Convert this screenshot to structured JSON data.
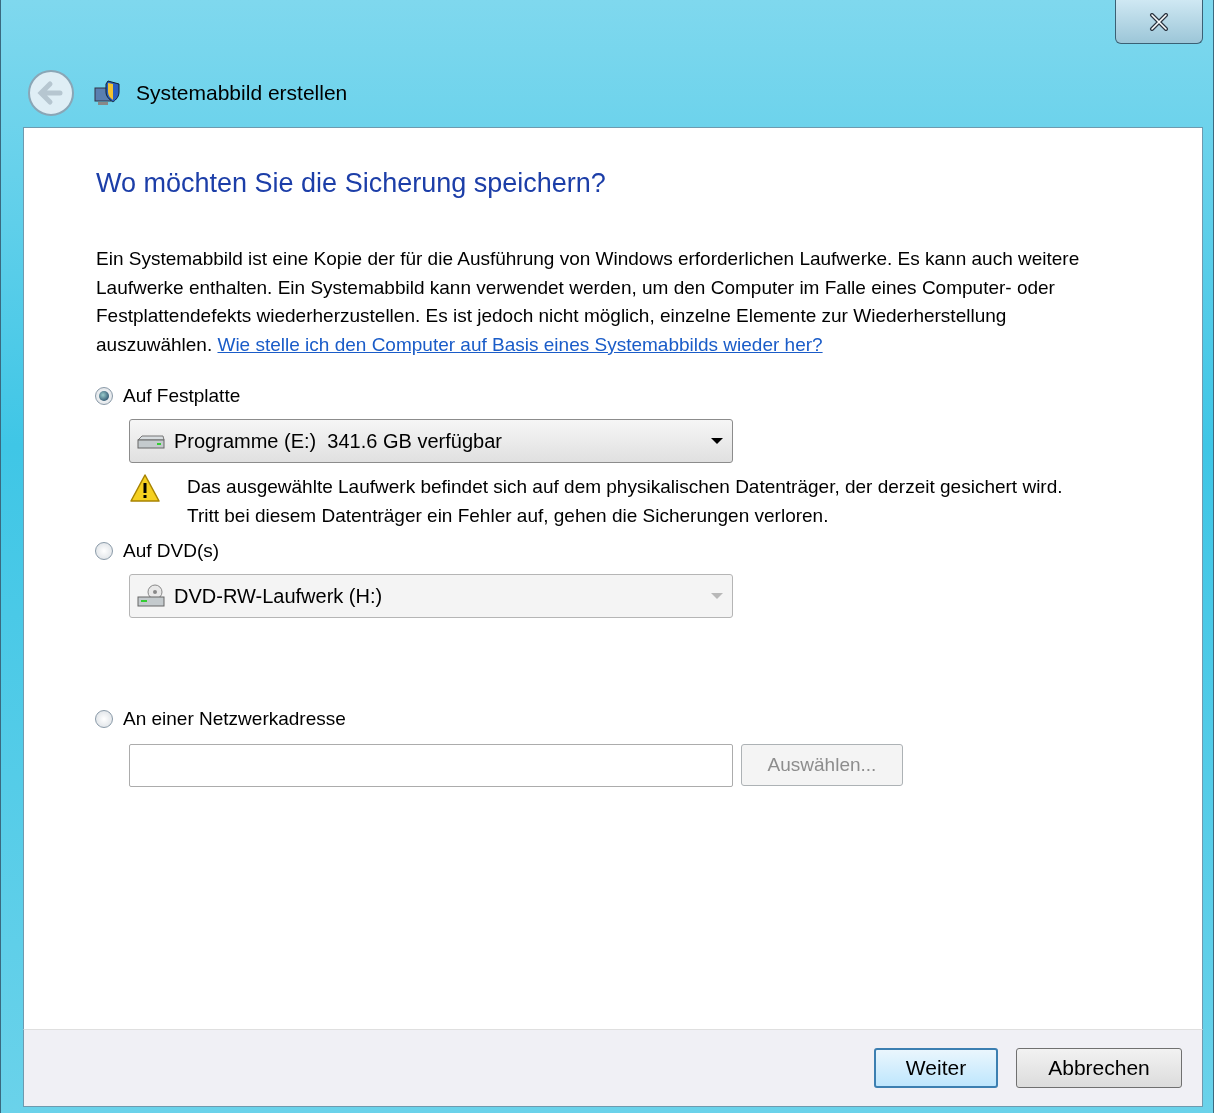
{
  "window": {
    "title": "Systemabbild erstellen"
  },
  "heading": "Wo möchten Sie die Sicherung speichern?",
  "description": {
    "text": "Ein Systemabbild ist eine Kopie der für die Ausführung von Windows erforderlichen Laufwerke. Es kann auch weitere Laufwerke enthalten. Ein Systemabbild kann verwendet werden, um den Computer im Falle eines Computer- oder Festplattendefekts wiederherzustellen. Es ist jedoch nicht möglich, einzelne Elemente zur Wiederherstellung auszuwählen.",
    "link": "Wie stelle ich den Computer auf Basis eines Systemabbilds wieder her?"
  },
  "options": [
    {
      "kind": "disk",
      "label": "Auf Festplatte",
      "selected": true,
      "dropdown": {
        "value": "Programme (E:)  341.6 GB verfügbar",
        "disabled": false
      },
      "warning": "Das ausgewählte Laufwerk befindet sich auf dem physikalischen Datenträger, der derzeit gesichert wird. Tritt bei diesem Datenträger ein Fehler auf, gehen die Sicherungen verloren."
    },
    {
      "kind": "dvd",
      "label": "Auf DVD(s)",
      "selected": false,
      "dropdown": {
        "value": "DVD-RW-Laufwerk (H:)",
        "disabled": true
      }
    },
    {
      "kind": "network",
      "label": "An einer Netzwerkadresse",
      "selected": false,
      "button": {
        "label": "Auswählen...",
        "disabled": true
      }
    }
  ],
  "buttons": [
    {
      "label": "Weiter",
      "default": true
    },
    {
      "label": "Abbrechen",
      "default": false
    }
  ]
}
